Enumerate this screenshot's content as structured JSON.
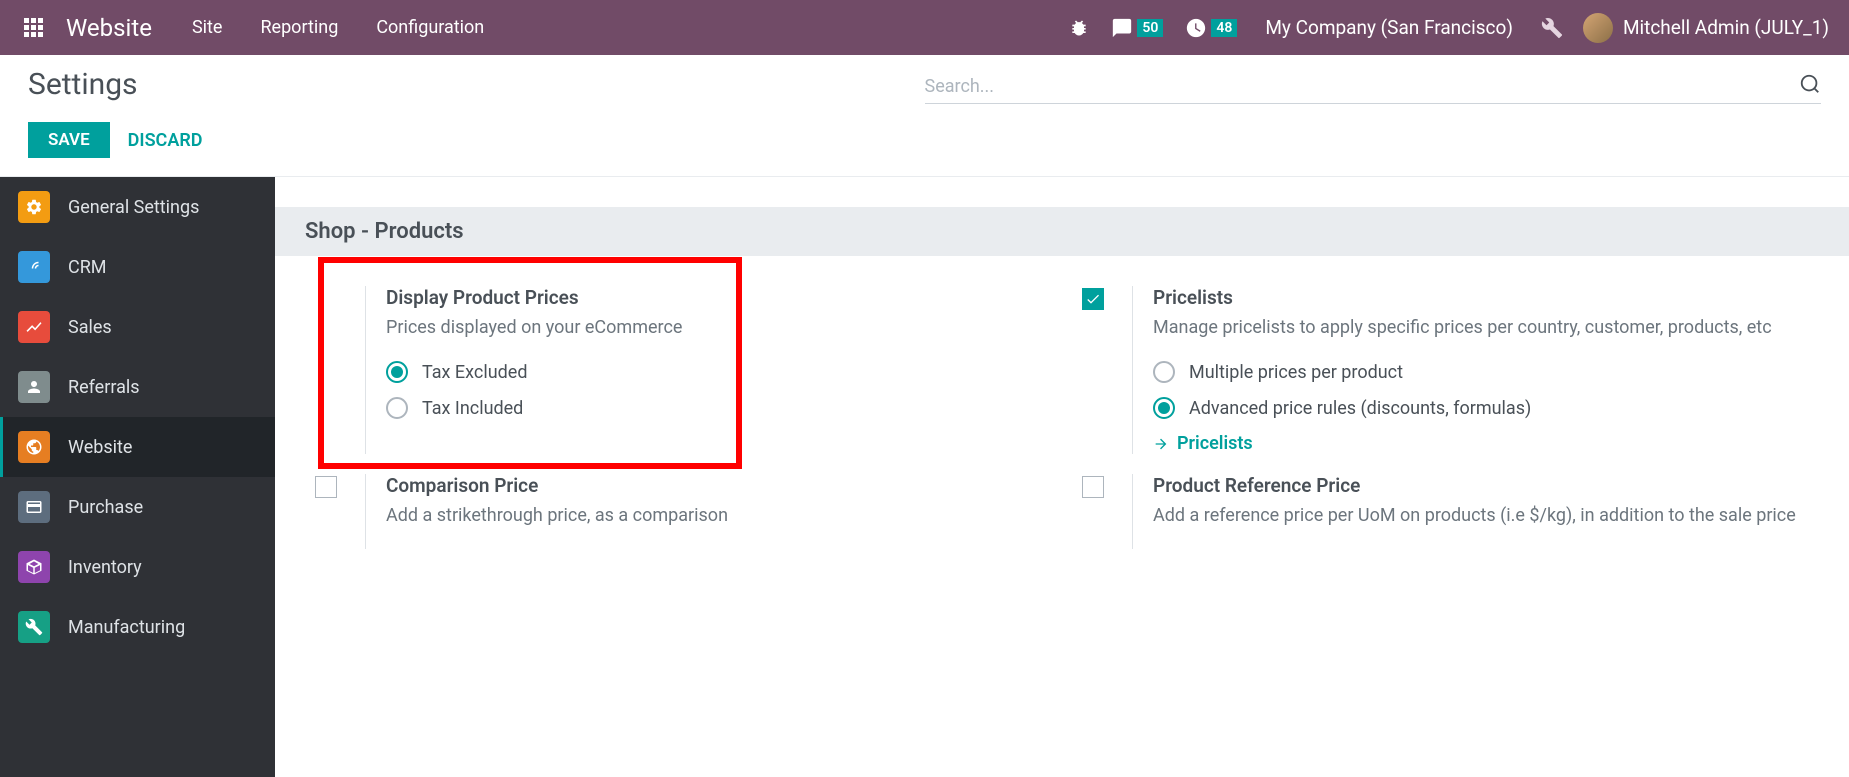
{
  "navbar": {
    "brand": "Website",
    "links": [
      "Site",
      "Reporting",
      "Configuration"
    ],
    "messages_count": "50",
    "activities_count": "48",
    "company": "My Company (San Francisco)",
    "username": "Mitchell Admin (JULY_1)"
  },
  "control_panel": {
    "title": "Settings",
    "save": "SAVE",
    "discard": "DISCARD",
    "search_placeholder": "Search..."
  },
  "sidebar": {
    "items": [
      {
        "label": "General Settings"
      },
      {
        "label": "CRM"
      },
      {
        "label": "Sales"
      },
      {
        "label": "Referrals"
      },
      {
        "label": "Website"
      },
      {
        "label": "Purchase"
      },
      {
        "label": "Inventory"
      },
      {
        "label": "Manufacturing"
      }
    ]
  },
  "section": {
    "title": "Shop - Products"
  },
  "settings": {
    "display_prices": {
      "title": "Display Product Prices",
      "desc": "Prices displayed on your eCommerce",
      "opt1": "Tax Excluded",
      "opt2": "Tax Included"
    },
    "pricelists": {
      "title": "Pricelists",
      "desc": "Manage pricelists to apply specific prices per country, customer, products, etc",
      "opt1": "Multiple prices per product",
      "opt2": "Advanced price rules (discounts, formulas)",
      "link": "Pricelists"
    },
    "comparison": {
      "title": "Comparison Price",
      "desc": "Add a strikethrough price, as a comparison"
    },
    "reference": {
      "title": "Product Reference Price",
      "desc": "Add a reference price per UoM on products (i.e $/kg), in addition to the sale price"
    }
  }
}
